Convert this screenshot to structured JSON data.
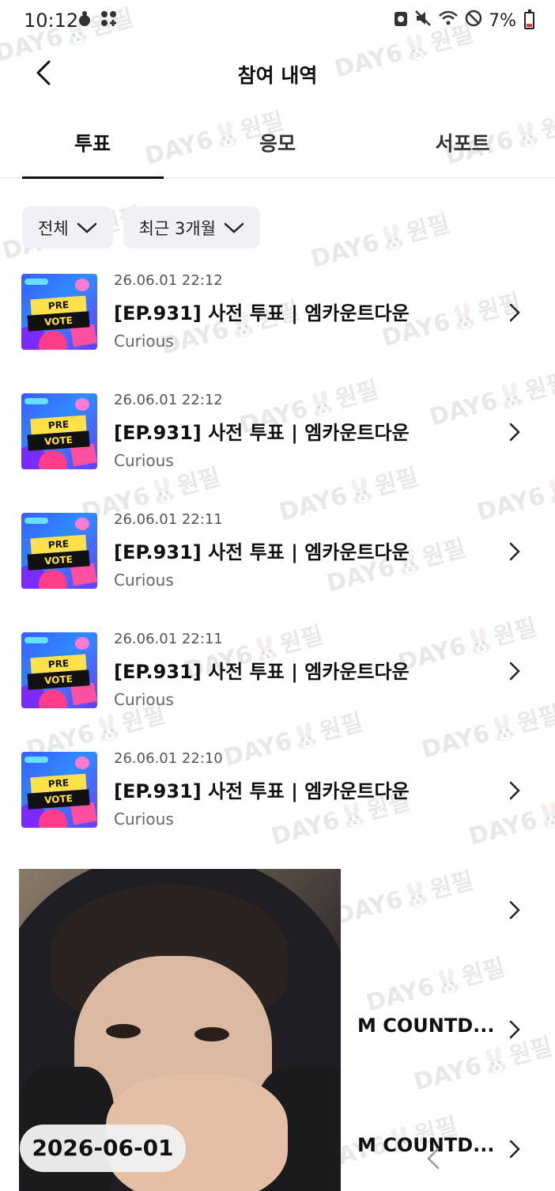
{
  "status_bar": {
    "time": "10:12",
    "battery": "7%",
    "icons": [
      "game-icon",
      "apps-icon",
      "recycle-icon",
      "mute-icon",
      "wifi-icon",
      "block-icon",
      "battery-icon"
    ]
  },
  "header": {
    "title": "참여 내역",
    "back_icon": "back-arrow-icon"
  },
  "tabs": [
    {
      "label": "투표",
      "active": true
    },
    {
      "label": "응모",
      "active": false
    },
    {
      "label": "서포트",
      "active": false
    }
  ],
  "filters": [
    {
      "label": "전체"
    },
    {
      "label": "최근 3개월"
    }
  ],
  "thumbnail": {
    "line1": "PRE",
    "line2": "VOTE"
  },
  "items": [
    {
      "date": "26.06.01 22:12",
      "title": "[EP.931] 사전 투표 | 엠카운트다운",
      "subtitle": "Curious"
    },
    {
      "date": "26.06.01 22:12",
      "title": "[EP.931] 사전 투표 | 엠카운트다운",
      "subtitle": "Curious"
    },
    {
      "date": "26.06.01 22:11",
      "title": "[EP.931] 사전 투표 | 엠카운트다운",
      "subtitle": "Curious"
    },
    {
      "date": "26.06.01 22:11",
      "title": "[EP.931] 사전 투표 | 엠카운트다운",
      "subtitle": "Curious"
    },
    {
      "date": "26.06.01 22:10",
      "title": "[EP.931] 사전 투표 | 엠카운트다운",
      "subtitle": "Curious"
    }
  ],
  "partial_items": [
    {
      "title": ""
    },
    {
      "title": "M COUNTD..."
    },
    {
      "title": "M COUNTD..."
    }
  ],
  "overlay": {
    "date_badge": "2026-06-01"
  },
  "watermark": "DAY6🐰원필"
}
